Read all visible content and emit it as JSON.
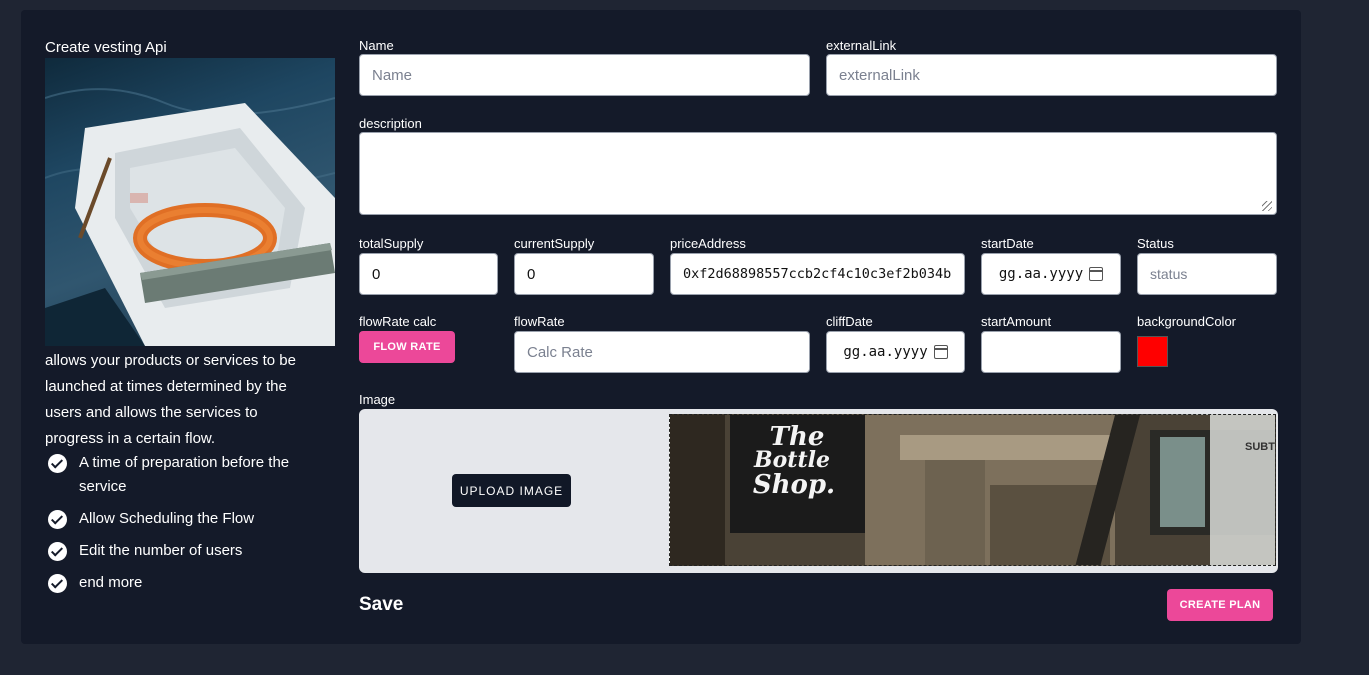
{
  "sidebar": {
    "title": "Create vesting Api",
    "description": "allows your products or services to be launched at times determined by the users and allows the services to progress in a certain flow.",
    "features": [
      "A time of preparation before the service",
      "Allow Scheduling the Flow",
      "Edit the number of users",
      "end more"
    ]
  },
  "form": {
    "name": {
      "label": "Name",
      "placeholder": "Name"
    },
    "externalLink": {
      "label": "externalLink",
      "placeholder": "externalLink"
    },
    "description": {
      "label": "description",
      "placeholder": ""
    },
    "totalSupply": {
      "label": "totalSupply",
      "value": "0"
    },
    "currentSupply": {
      "label": "currentSupply",
      "value": "0"
    },
    "priceAddress": {
      "label": "priceAddress",
      "value": "0xf2d68898557ccb2cf4c10c3ef2b034b"
    },
    "startDate": {
      "label": "startDate",
      "value": "gg.aa.yyyy"
    },
    "status": {
      "label": "Status",
      "placeholder": "status"
    },
    "flowRateCalc": {
      "label": "flowRate calc",
      "button": "FLOW RATE"
    },
    "flowRate": {
      "label": "flowRate",
      "placeholder": "Calc Rate"
    },
    "cliffDate": {
      "label": "cliffDate",
      "value": "gg.aa.yyyy"
    },
    "startAmount": {
      "label": "startAmount",
      "value": ""
    },
    "backgroundColor": {
      "label": "backgroundColor",
      "value": "#ff0000"
    },
    "image": {
      "label": "Image",
      "upload_button": "UPLOAD IMAGE",
      "preview_sign": [
        "The",
        "Bottle",
        "Shop."
      ],
      "preview_side_text": "SUBT"
    }
  },
  "footer": {
    "save_label": "Save",
    "create_button": "CREATE PLAN"
  },
  "colors": {
    "accent": "#ec4899",
    "panel": "#141a29",
    "page": "#1f2533"
  }
}
